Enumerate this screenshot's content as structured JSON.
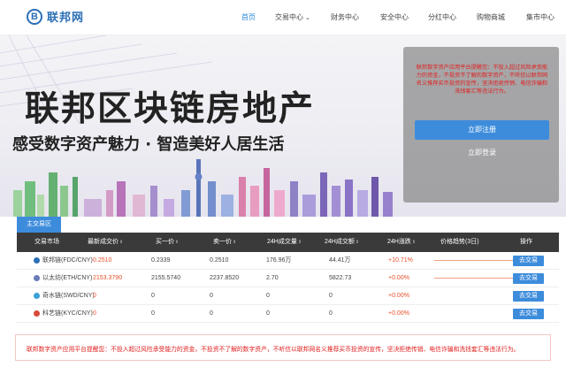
{
  "header": {
    "logo_text": "联邦网",
    "logo_mark": "B",
    "nav": [
      {
        "label": "首页",
        "active": true,
        "dropdown": false
      },
      {
        "label": "交易中心",
        "active": false,
        "dropdown": true
      },
      {
        "label": "财务中心",
        "active": false,
        "dropdown": false
      },
      {
        "label": "安全中心",
        "active": false,
        "dropdown": false
      },
      {
        "label": "分红中心",
        "active": false,
        "dropdown": false
      },
      {
        "label": "购物商城",
        "active": false,
        "dropdown": false
      },
      {
        "label": "集市中心",
        "active": false,
        "dropdown": false
      }
    ]
  },
  "banner": {
    "title": "联邦区块链房地产",
    "subtitle": "感受数字资产魅力 · 智造美好人居生活"
  },
  "login_panel": {
    "notice": "联邦数字资产应用平台提醒您：不投入超过风险承受能力的资金，不投资不了解的数字资产，不听信以联邦网名义推荐买币投资的宣传，坚决拒绝传销、电信诈骗和洗钱套汇等违法行为。",
    "register_label": "立即注册",
    "login_label": "立即登录"
  },
  "market": {
    "tab_label": "主交易区",
    "columns": [
      "交易市场",
      "最新成交价",
      "买一价",
      "卖一价",
      "24H成交量",
      "24H成交额",
      "24H涨跌",
      "价格趋势(3日)",
      "操作"
    ],
    "rows": [
      {
        "market": "联邦链(FDC/CNY)",
        "price": "0.2510",
        "bid": "0.2339",
        "ask": "0.2510",
        "volume": "176.96万",
        "amount": "44.41万",
        "change": "+10.71%",
        "trend": true,
        "action": "去交易",
        "icon_color": "#2b6fb6"
      },
      {
        "market": "以太坊(ETH/CNY)",
        "price": "2153.3790",
        "bid": "2155.5740",
        "ask": "2237.8520",
        "volume": "2.70",
        "amount": "5822.73",
        "change": "+0.00%",
        "trend": true,
        "action": "去交易",
        "icon_color": "#6b7bb8"
      },
      {
        "market": "奇水链(SWD/CNY)",
        "price": "0",
        "bid": "0",
        "ask": "0",
        "volume": "0",
        "amount": "0",
        "change": "+0.00%",
        "trend": false,
        "action": "去交易",
        "icon_color": "#3aa0d8"
      },
      {
        "market": "科艺链(KYC/CNY)",
        "price": "0",
        "bid": "0",
        "ask": "0",
        "volume": "0",
        "amount": "0",
        "change": "+0.00%",
        "trend": false,
        "action": "去交易",
        "icon_color": "#d84a3a"
      }
    ]
  },
  "footer": {
    "notice": "联邦数字资产应用平台提醒您：不投入超过风险承受能力的资金，不投资不了解的数字资产，不听信以联邦网名义推荐买币投资的宣传，坚决拒绝传销、电信诈骗和洗钱套汇等违法行为。"
  },
  "colors": {
    "accent": "#3d8cdc",
    "warning": "#e02020",
    "up": "#e8502a",
    "table_header": "#3a3a3a"
  }
}
